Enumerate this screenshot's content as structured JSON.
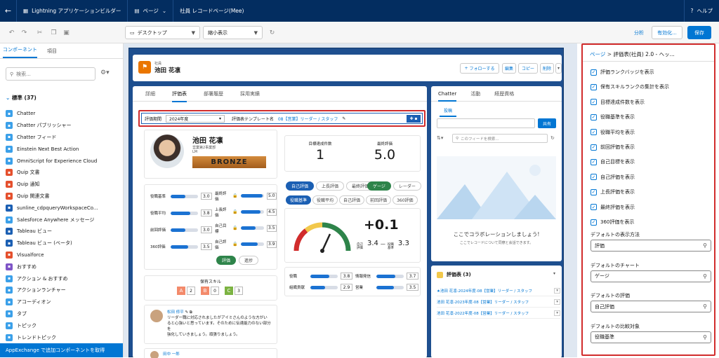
{
  "topbar": {
    "back_icon": "arrow-left-icon",
    "app_title": "Lightning アプリケーションビルダー",
    "page_menu": "ページ",
    "record_page": "社員 レコードページ(Mee)",
    "help": "ヘルプ"
  },
  "toolbar": {
    "device": "デスクトップ",
    "zoom": "縮小表示",
    "analyze": "分析",
    "activate": "有効化...",
    "save": "保存"
  },
  "left_panel": {
    "tabs": [
      "コンポーネント",
      "項目"
    ],
    "search_placeholder": "検索...",
    "section": "標準 (37)",
    "components": [
      {
        "label": "Chatter",
        "color": "#3ba0e9"
      },
      {
        "label": "Chatter パブリッシャー",
        "color": "#3ba0e9"
      },
      {
        "label": "Chatter フィード",
        "color": "#3ba0e9"
      },
      {
        "label": "Einstein Next Best Action",
        "color": "#3ba0e9"
      },
      {
        "label": "OmniScript for Experience Cloud",
        "color": "#3ba0e9"
      },
      {
        "label": "Quip 文書",
        "color": "#e5502d"
      },
      {
        "label": "Quip 通知",
        "color": "#e5502d"
      },
      {
        "label": "Quip 関連文書",
        "color": "#e5502d"
      },
      {
        "label": "sunline_cdpqueryWorkspaceCo...",
        "color": "#1b5fb3"
      },
      {
        "label": "Salesforce Anywhere メッセージ",
        "color": "#3ba0e9"
      },
      {
        "label": "Tableau ビュー",
        "color": "#1b5fb3"
      },
      {
        "label": "Tableau ビュー (ベータ)",
        "color": "#1b5fb3"
      },
      {
        "label": "Visualforce",
        "color": "#e5502d"
      },
      {
        "label": "おすすめ",
        "color": "#7f55c7"
      },
      {
        "label": "アクション & おすすめ",
        "color": "#3ba0e9"
      },
      {
        "label": "アクションランチャー",
        "color": "#3ba0e9"
      },
      {
        "label": "アコーディオン",
        "color": "#3ba0e9"
      },
      {
        "label": "タブ",
        "color": "#3ba0e9"
      },
      {
        "label": "トピック",
        "color": "#3ba0e9"
      },
      {
        "label": "トレンドトピック",
        "color": "#3ba0e9"
      }
    ],
    "appexchange": "AppExchange で追加コンポーネントを取得"
  },
  "record": {
    "object": "社員",
    "name": "池田 花凛",
    "follow": "フォローする",
    "edit": "編集",
    "copy": "コピー",
    "delete": "削除",
    "tabs": [
      "詳細",
      "評価表",
      "部署履歴",
      "採用実績"
    ],
    "period_label": "評価期間",
    "period_value": "2024年度",
    "template_label": "評価表テンプレート名",
    "template_value": "08【営業】リーダー / スタッフ",
    "employee_name": "池田 花凛",
    "employee_dept": "営業第2事業部",
    "employee_role": "LM",
    "rank": "BRONZE",
    "goals_label": "目標達成件数",
    "goals_value": "1",
    "final_label": "最終評価",
    "final_value": "5.0",
    "eval_rows": [
      {
        "label": "役職基準",
        "value": "3.0",
        "fill": 0.55
      },
      {
        "label": "役職平均",
        "value": "3.8",
        "fill": 0.72
      },
      {
        "label": "前回評価",
        "value": "3.0",
        "fill": 0.55
      },
      {
        "label": "360評価",
        "value": "3.5",
        "fill": 0.65
      }
    ],
    "eval_rows2": [
      {
        "label": "最終評価",
        "value": "5.0",
        "fill": 0.95
      },
      {
        "label": "上長評価",
        "value": "4.5",
        "fill": 0.85
      },
      {
        "label": "自己目標",
        "value": "3.5",
        "fill": 0.65
      },
      {
        "label": "自己評価",
        "value": "3.9",
        "fill": 0.74
      }
    ],
    "toggle_eval": "評価",
    "toggle_progress": "進捗",
    "skills_label": "保有スキル",
    "skills": [
      {
        "grade": "A",
        "count": "2",
        "color": "#f38a6b"
      },
      {
        "grade": "B",
        "count": "0",
        "color": "#f38a6b"
      },
      {
        "grade": "C",
        "count": "3",
        "color": "#7cb342"
      }
    ],
    "chart_pills_a": [
      "自己評価",
      "上長評価",
      "最終評価"
    ],
    "chart_pills_b": [
      "ゲージ",
      "レーダー"
    ],
    "chart_pills_c": [
      "役職基準",
      "役職平均",
      "自己評価",
      "前回評価",
      "360評価"
    ],
    "delta": "+0.1",
    "delta_left_label": "自己評価",
    "delta_left": "3.4",
    "delta_right_label": "役職基準",
    "delta_right": "3.3",
    "bottom_rows": [
      {
        "label": "役職",
        "value": "3.8",
        "fill": 0.7
      },
      {
        "label": "組織貢献",
        "value": "2.9",
        "fill": 0.55
      },
      {
        "label": "情報発信",
        "value": "3.7",
        "fill": 0.7
      },
      {
        "label": "営業",
        "value": "3.5",
        "fill": 0.65
      }
    ],
    "post_author": "松田 修平",
    "post_text": "リーダー職に対応されましたがアイミさんのような方がいると心強いと思っています。そのために伝達能力のない部分を",
    "post_text2": "強化していきましょう。頑張りましょう。",
    "post2_author": "田中 一郎"
  },
  "chatter": {
    "tabs": [
      "Chatter",
      "活動",
      "経歴資格"
    ],
    "post_tab": "投稿",
    "share": "共有",
    "search_placeholder": "このフィードを検索...",
    "empty_title": "ここでコラボレーションしましょう!",
    "empty_text": "ここでレコードについて同僚と会話できます。"
  },
  "related": {
    "title": "評価表 (3)",
    "items": [
      "★池田 花凛-2024年度-08【営業】リーダー / スタッフ",
      "池田 花凛-2023年度-08【営業】リーダー / スタッフ",
      "池田 花凛-2022年度-08【営業】リーダー / スタッフ"
    ]
  },
  "properties": {
    "breadcrumb_root": "ページ",
    "breadcrumb_sep": ">",
    "breadcrumb_current": "評価表(社員) 2.0 - ヘッ...",
    "checkboxes": [
      "評価ランクバッジを表示",
      "保有スキルランクの集計を表示",
      "目標達成件数を表示",
      "役職基準を表示",
      "役職平均を表示",
      "前回評価を表示",
      "自己目標を表示",
      "自己評価を表示",
      "上長評価を表示",
      "最終評価を表示",
      "360評価を表示"
    ],
    "fields": [
      {
        "label": "デフォルトの表示方法",
        "value": "評価"
      },
      {
        "label": "デフォルトのチャート",
        "value": "ゲージ"
      },
      {
        "label": "デフォルトの評価",
        "value": "自己評価"
      },
      {
        "label": "デフォルトの比較対象",
        "value": "役職基準"
      }
    ]
  }
}
